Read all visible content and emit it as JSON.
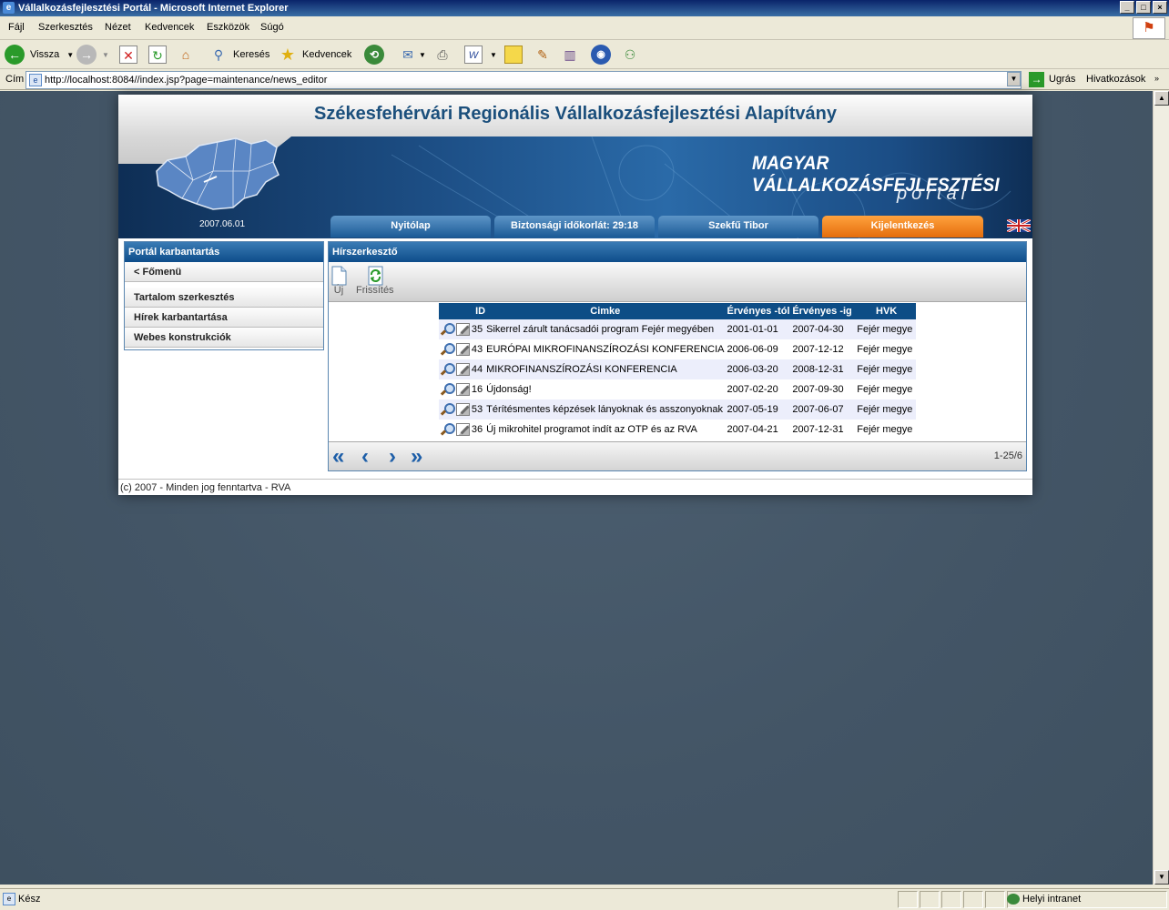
{
  "window": {
    "title": "Vállalkozásfejlesztési Portál - Microsoft Internet Explorer"
  },
  "menu": [
    "Fájl",
    "Szerkesztés",
    "Nézet",
    "Kedvencek",
    "Eszközök",
    "Súgó"
  ],
  "toolbar": {
    "back": "Vissza",
    "search": "Keresés",
    "favorites": "Kedvencek"
  },
  "address": {
    "label": "Cím",
    "url": "http://localhost:8084//index.jsp?page=maintenance/news_editor",
    "go": "Ugrás",
    "links": "Hivatkozások"
  },
  "header": {
    "title": "Székesfehérvári Regionális Vállalkozásfejlesztési Alapítvány",
    "brand_line1": "MAGYAR VÁLLALKOZÁSFEJLESZTÉSI",
    "brand_line2": "portál",
    "date": "2007.06.01",
    "tabs": [
      "Nyitólap",
      "Biztonsági időkorlát: 29:18",
      "Szekfű Tibor",
      "Kijelentkezés"
    ]
  },
  "colors": {
    "accent_blue": "#0d4d86",
    "tab_orange": "#f08418",
    "page_bg": "#435566"
  },
  "leftnav": {
    "title": "Portál karbantartás",
    "back": "< Főmenü",
    "items": [
      "Tartalom szerkesztés",
      "Hírek karbantartása",
      "Webes konstrukciók"
    ]
  },
  "main": {
    "title": "Hírszerkesztő",
    "tools": {
      "new": "Új",
      "refresh": "Frissítés"
    },
    "columns": [
      "ID",
      "Cimke",
      "Érvényes -tól",
      "Érvényes -ig",
      "HVK"
    ],
    "rows": [
      {
        "id": "35",
        "label": "Sikerrel zárult tanácsadói program Fejér megyében",
        "from": "2001-01-01",
        "to": "2007-04-30",
        "hvk": "Fejér megye"
      },
      {
        "id": "43",
        "label": "EURÓPAI MIKROFINANSZÍROZÁSI KONFERENCIA",
        "from": "2006-06-09",
        "to": "2007-12-12",
        "hvk": "Fejér megye"
      },
      {
        "id": "44",
        "label": "MIKROFINANSZÍROZÁSI KONFERENCIA",
        "from": "2006-03-20",
        "to": "2008-12-31",
        "hvk": "Fejér megye"
      },
      {
        "id": "16",
        "label": "Újdonság!",
        "from": "2007-02-20",
        "to": "2007-09-30",
        "hvk": "Fejér megye"
      },
      {
        "id": "53",
        "label": "Térítésmentes képzések lányoknak és asszonyoknak",
        "from": "2007-05-19",
        "to": "2007-06-07",
        "hvk": "Fejér megye"
      },
      {
        "id": "36",
        "label": "Új mikrohitel programot indít az OTP és az RVA",
        "from": "2007-04-21",
        "to": "2007-12-31",
        "hvk": "Fejér megye"
      }
    ],
    "pager": {
      "first": "«",
      "prev": "‹",
      "next": "›",
      "last": "»",
      "count": "1-25/6"
    }
  },
  "footer": "(c) 2007 - Minden jog fenntartva - RVA",
  "status": {
    "text": "Kész",
    "zone": "Helyi intranet"
  }
}
